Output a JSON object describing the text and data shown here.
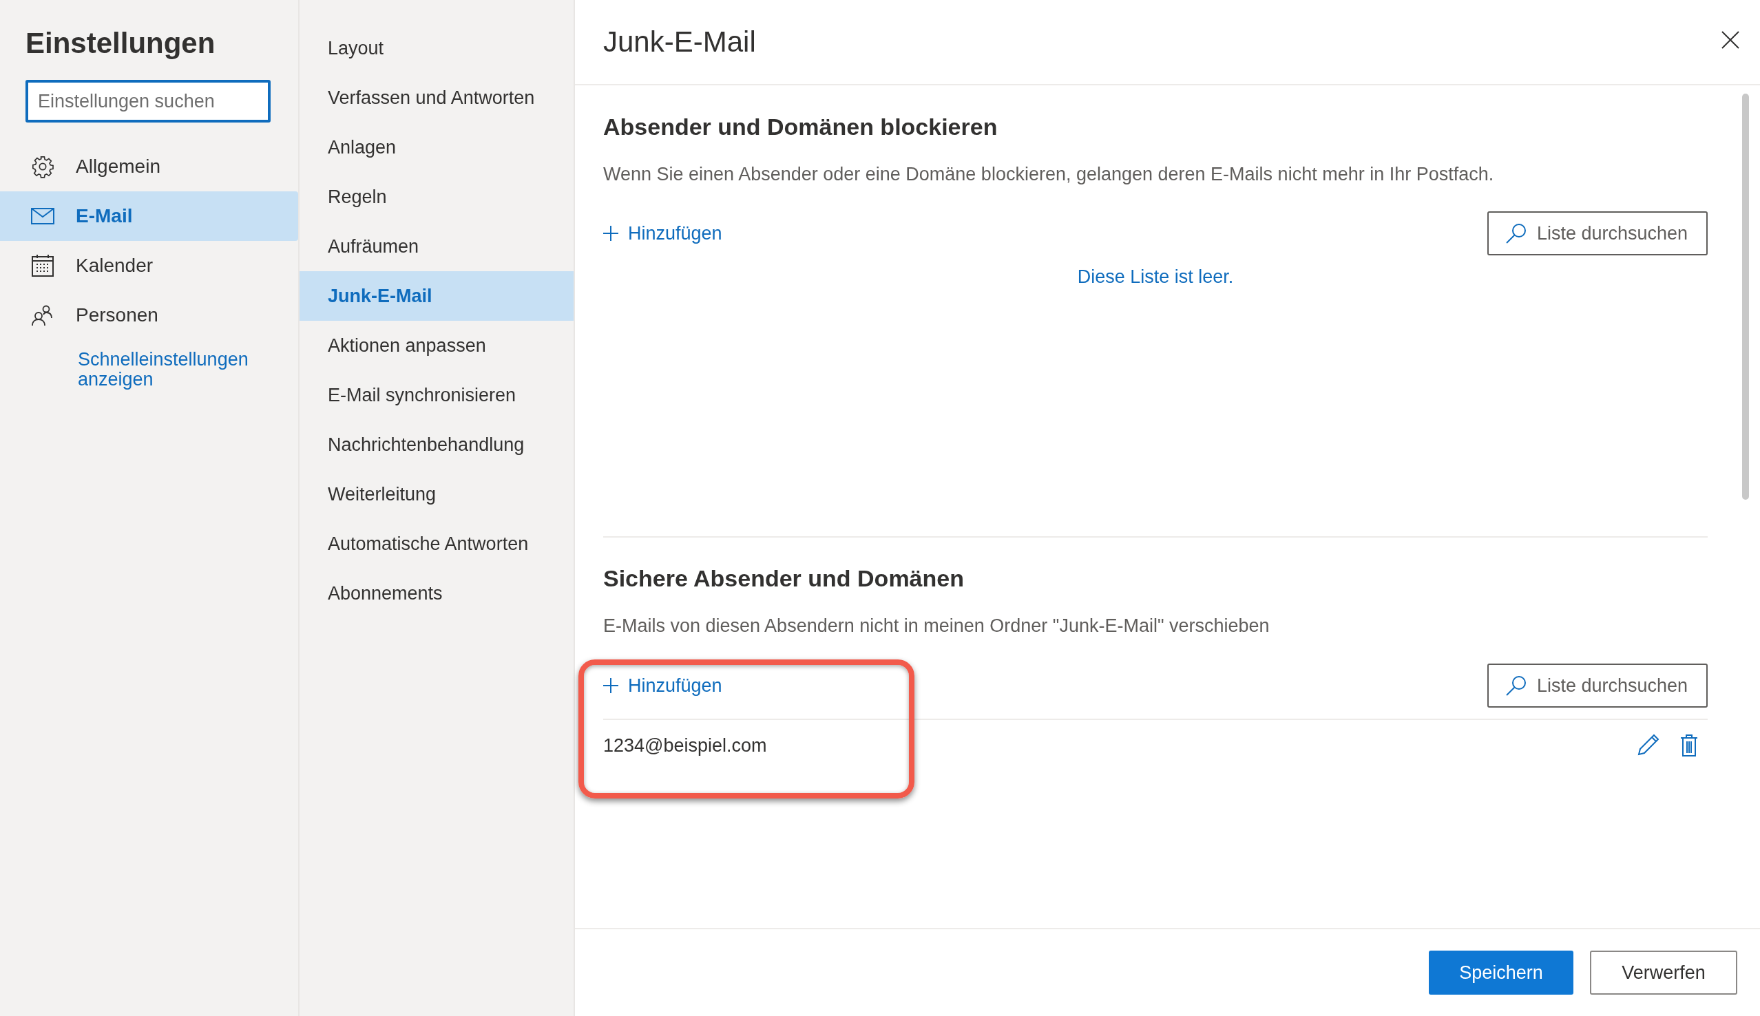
{
  "sidebar": {
    "title": "Einstellungen",
    "search": {
      "placeholder": "Einstellungen suchen"
    },
    "items": [
      {
        "label": "Allgemein",
        "selected": false
      },
      {
        "label": "E-Mail",
        "selected": true
      },
      {
        "label": "Kalender",
        "selected": false
      },
      {
        "label": "Personen",
        "selected": false
      }
    ],
    "quick_link": "Schnelleinstellungen anzeigen"
  },
  "categories": [
    {
      "label": "Layout",
      "selected": false
    },
    {
      "label": "Verfassen und Antworten",
      "selected": false
    },
    {
      "label": "Anlagen",
      "selected": false
    },
    {
      "label": "Regeln",
      "selected": false
    },
    {
      "label": "Aufräumen",
      "selected": false
    },
    {
      "label": "Junk-E-Mail",
      "selected": true
    },
    {
      "label": "Aktionen anpassen",
      "selected": false
    },
    {
      "label": "E-Mail synchronisieren",
      "selected": false
    },
    {
      "label": "Nachrichtenbehandlung",
      "selected": false
    },
    {
      "label": "Weiterleitung",
      "selected": false
    },
    {
      "label": "Automatische Antworten",
      "selected": false
    },
    {
      "label": "Abonnements",
      "selected": false
    }
  ],
  "pane": {
    "title": "Junk-E-Mail",
    "sections": [
      {
        "title": "Absender und Domänen blockieren",
        "description": "Wenn Sie einen Absender oder eine Domäne blockieren, gelangen deren E-Mails nicht mehr in Ihr Postfach.",
        "add_label": "Hinzufügen",
        "search_label": "Liste durchsuchen",
        "empty_text": "Diese Liste ist leer."
      },
      {
        "title": "Sichere Absender und Domänen",
        "description": "E-Mails von diesen Absendern nicht in meinen Ordner \"Junk-E-Mail\" verschieben",
        "add_label": "Hinzufügen",
        "search_label": "Liste durchsuchen",
        "highlighted": true,
        "entries": [
          {
            "address": "1234@beispiel.com"
          }
        ]
      }
    ],
    "buttons": [
      {
        "label": "Speichern",
        "kind": "primary"
      },
      {
        "label": "Verwerfen",
        "kind": "secondary"
      }
    ]
  }
}
